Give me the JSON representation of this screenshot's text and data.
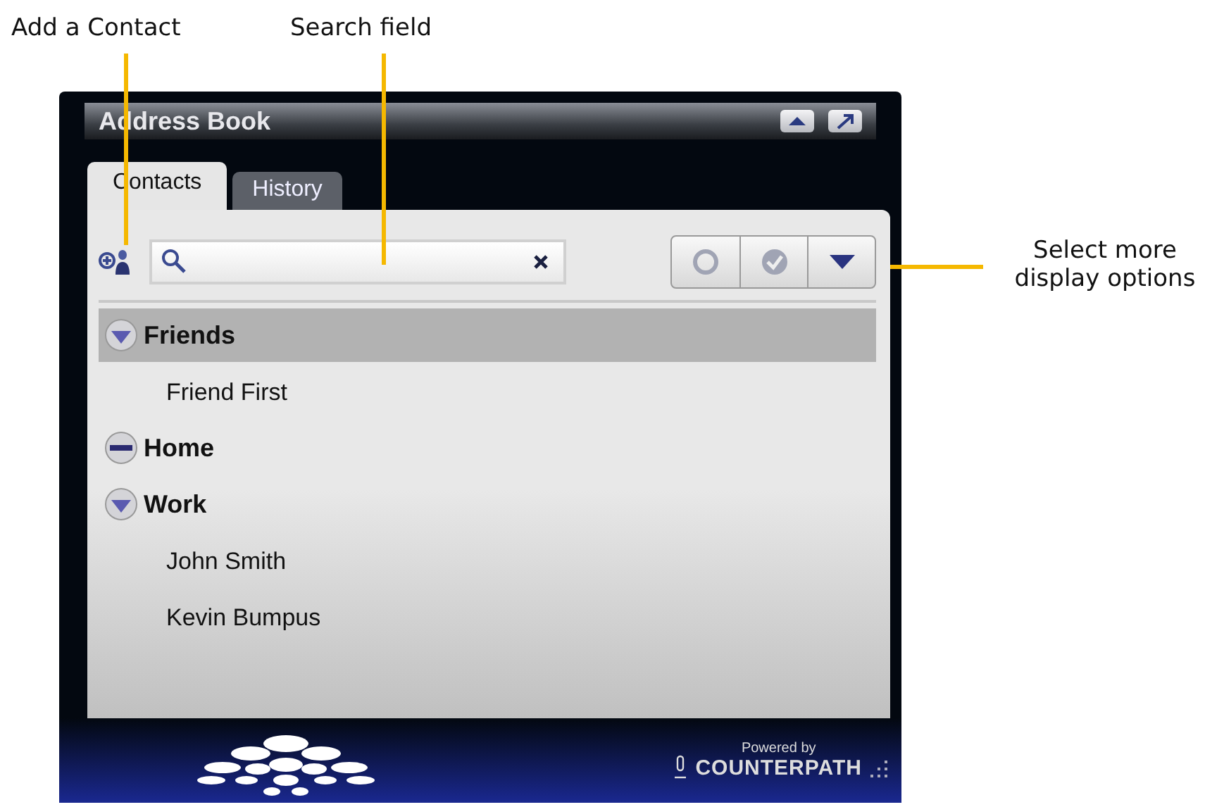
{
  "callouts": [
    {
      "label": "Add a Contact"
    },
    {
      "label": "Search field"
    },
    {
      "label": "Select more display options"
    }
  ],
  "window": {
    "title": "Address Book"
  },
  "tabs": [
    {
      "label": "Contacts",
      "selected": true
    },
    {
      "label": "History",
      "selected": false
    }
  ],
  "groups": [
    {
      "name": "Friends",
      "expanded": true,
      "selected": true,
      "children": [
        {
          "name": "Friend First"
        }
      ]
    },
    {
      "name": "Home",
      "expanded": false,
      "selected": false
    },
    {
      "name": "Work",
      "expanded": true,
      "selected": false,
      "children": [
        {
          "name": "John Smith"
        },
        {
          "name": "Kevin Bumpus"
        }
      ]
    }
  ],
  "footer": {
    "powered_by": "Powered by",
    "brand": "COUNTERPATH"
  }
}
